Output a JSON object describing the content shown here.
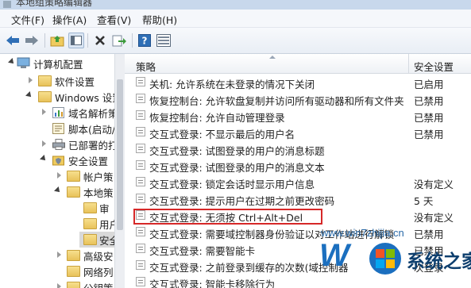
{
  "window": {
    "title": "本地组策略编辑器"
  },
  "menu": [
    "文件(F)",
    "操作(A)",
    "查看(V)",
    "帮助(H)"
  ],
  "toolbar": {
    "icons": [
      "back-arrow-icon",
      "forward-arrow-icon",
      "up-folder-icon",
      "show-tree-icon",
      "delete-icon",
      "export-icon",
      "help-icon",
      "view-icon"
    ]
  },
  "tree": {
    "items": [
      {
        "label": "计算机配置",
        "level": 0,
        "expanded": true
      },
      {
        "label": "软件设置",
        "level": 1,
        "expanded": false
      },
      {
        "label": "Windows 设置",
        "level": 1,
        "expanded": true
      },
      {
        "label": "域名解析策",
        "level": 2,
        "expanded": false
      },
      {
        "label": "脚本(启动/",
        "level": 2,
        "expanded": false
      },
      {
        "label": "已部署的打",
        "level": 2,
        "expanded": false
      },
      {
        "label": "安全设置",
        "level": 2,
        "expanded": true
      },
      {
        "label": "帐户策",
        "level": 3,
        "expanded": false
      },
      {
        "label": "本地策",
        "level": 3,
        "expanded": true
      },
      {
        "label": "审",
        "level": 4,
        "expanded": false
      },
      {
        "label": "用户",
        "level": 4,
        "expanded": false
      },
      {
        "label": "安全",
        "level": 4,
        "expanded": false,
        "selected": true
      },
      {
        "label": "高级安",
        "level": 3,
        "expanded": false
      },
      {
        "label": "网络列",
        "level": 3,
        "expanded": false
      },
      {
        "label": "公钥策",
        "level": 3,
        "expanded": false
      }
    ]
  },
  "list": {
    "columns": {
      "policy": "策略",
      "setting": "安全设置"
    },
    "rows": [
      {
        "policy": "关机: 允许系统在未登录的情况下关闭",
        "setting": "已启用"
      },
      {
        "policy": "恢复控制台: 允许软盘复制并访问所有驱动器和所有文件夹",
        "setting": "已禁用"
      },
      {
        "policy": "恢复控制台: 允许自动管理登录",
        "setting": "已禁用"
      },
      {
        "policy": "交互式登录: 不显示最后的用户名",
        "setting": "已禁用"
      },
      {
        "policy": "交互式登录: 试图登录的用户的消息标题",
        "setting": ""
      },
      {
        "policy": "交互式登录: 试图登录的用户的消息文本",
        "setting": ""
      },
      {
        "policy": "交互式登录: 锁定会话时显示用户信息",
        "setting": "没有定义"
      },
      {
        "policy": "交互式登录: 提示用户在过期之前更改密码",
        "setting": "5 天"
      },
      {
        "policy": "交互式登录: 无须按 Ctrl+Alt+Del",
        "setting": "没有定义"
      },
      {
        "policy": "交互式登录: 需要域控制器身份验证以对工作站进行解锁",
        "setting": "已禁用"
      },
      {
        "policy": "交互式登录: 需要智能卡",
        "setting": "已禁用"
      },
      {
        "policy": "交互式登录: 之前登录到缓存的次数(域控制器",
        "setting": "次登录"
      },
      {
        "policy": "交互式登录: 智能卡移除行为",
        "setting": ""
      }
    ],
    "highlighted_row": 8
  },
  "watermark": {
    "url": "www.win7zhijia.cn",
    "logo_letter": "W",
    "logo_text": "系统之家"
  },
  "colors": {
    "highlight": "#d62828",
    "selection": "#cde8ff",
    "accent": "#1b6fbf"
  }
}
